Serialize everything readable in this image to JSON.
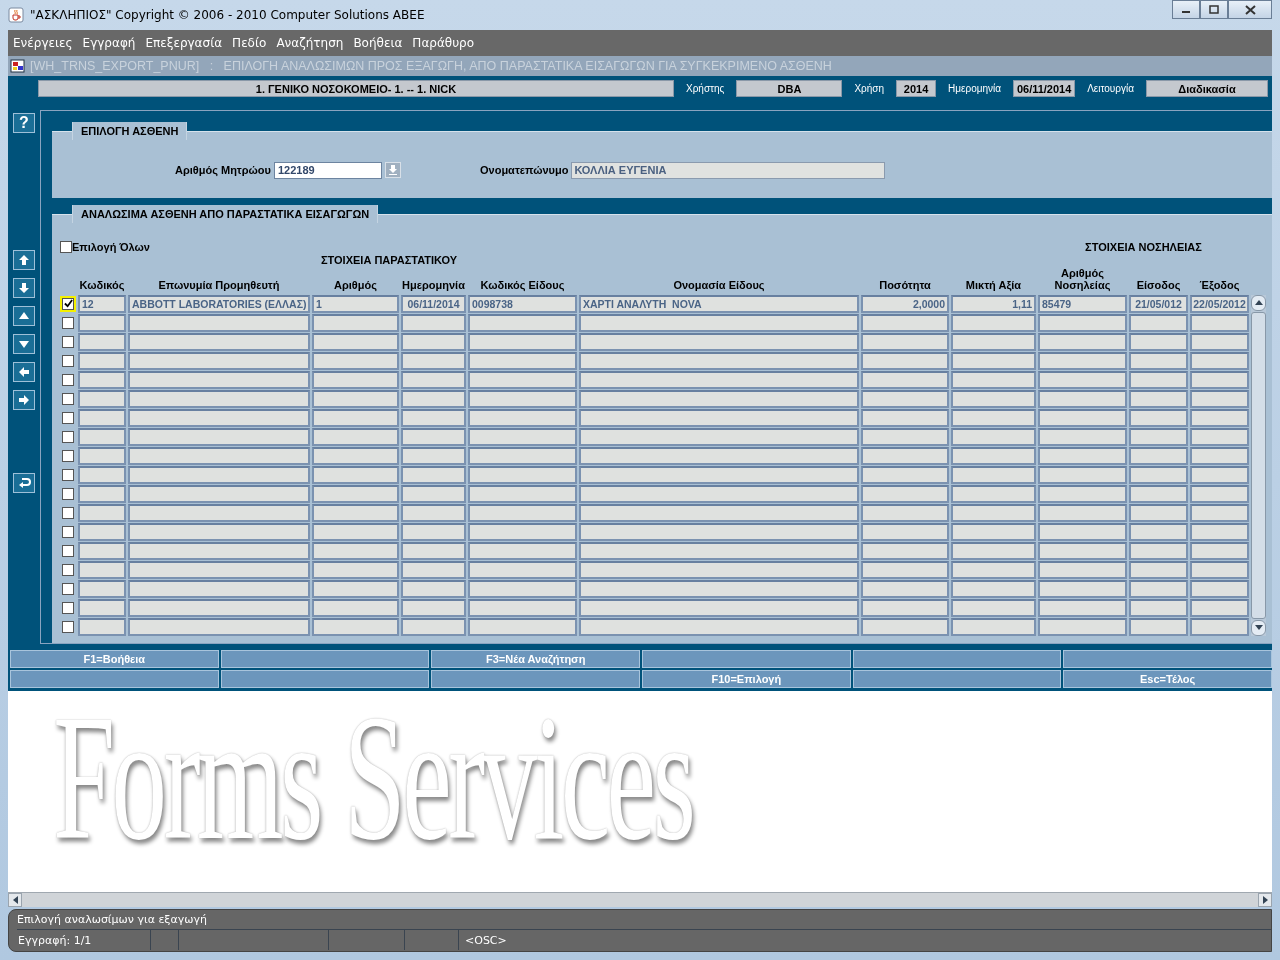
{
  "window": {
    "title": "\"ΑΣΚΛΗΠΙΟΣ\" Copyright © 2006 - 2010 Computer Solutions ABEE"
  },
  "menu": [
    "Ενέργειες",
    "Εγγραφή",
    "Επεξεργασία",
    "Πεδίο",
    "Αναζήτηση",
    "Βοήθεια",
    "Παράθυρο"
  ],
  "form_title": "[WH_TRNS_EXPORT_PNUR]   :   ΕΠΙΛΟΓΗ ΑΝΑΛΩΣΙΜΩΝ ΠΡΟΣ ΕΞΑΓΩΓΗ, ΑΠΟ ΠΑΡΑΣΤΑΤΙΚΑ ΕΙΣΑΓΩΓΩΝ ΓΙΑ ΣΥΓΚΕΚΡΙΜΕΝΟ ΑΣΘΕΝΗ",
  "header": {
    "hospital": "1. ΓΕΝΙΚΟ ΝΟΣΟΚΟΜΕΙΟ- 1. -- 1. NICK",
    "user_label": "Χρήστης",
    "user": "DBA",
    "year_label": "Χρήση",
    "year": "2014",
    "date_label": "Ημερομηνία",
    "date": "06/11/2014",
    "function_label": "Λειτουργία",
    "function": "Διαδικασία"
  },
  "toolbar": {
    "help": "?"
  },
  "patient": {
    "title": "ΕΠΙΛΟΓΗ ΑΣΘΕΝΗ",
    "record_label": "Αριθμός Μητρώου",
    "record": "122189",
    "name_label": "Ονοματεπώνυμο",
    "name": "ΚΟΛΛΙΑ ΕΥΓΕΝΙΑ"
  },
  "items": {
    "title": "ΑΝΑΛΩΣΙΜΑ ΑΣΘΕΝΗ ΑΠΟ ΠΑΡΑΣΤΑΤΙΚΑ ΕΙΣΑΓΩΓΩΝ",
    "select_all": {
      "label": "Επιλογή Όλων",
      "checked": false
    },
    "groups": [
      "ΣΤΟΙΧΕΙΑ ΠΑΡΑΣΤΑΤΙΚΟΥ",
      "ΣΤΟΙΧΕΙΑ ΝΟΣΗΛΕΙΑΣ"
    ],
    "columns": [
      "Κωδικός",
      "Επωνυμία Προμηθευτή",
      "Αριθμός",
      "Ημερομηνία",
      "Κωδικός Είδους",
      "Ονομασία Είδους",
      "Ποσότητα",
      "Μικτή Αξία",
      "Αριθμός Νοσηλείας",
      "Είσοδος",
      "Έξοδος"
    ],
    "rows": [
      {
        "checked": true,
        "selected": true,
        "cells": [
          "12",
          "ABBOTT LABORATORIES (ΕΛΛΑΣ)",
          "1",
          "06/11/2014",
          "0098738",
          "ΧΑΡΤΙ ΑΝΑΛΥΤΗ  NOVA",
          "2,0000",
          "1,11",
          "85479",
          "21/05/012",
          "22/05/2012"
        ]
      },
      {
        "checked": false,
        "selected": false
      },
      {
        "checked": false,
        "selected": false
      },
      {
        "checked": false,
        "selected": false
      },
      {
        "checked": false,
        "selected": false
      },
      {
        "checked": false,
        "selected": false
      },
      {
        "checked": false,
        "selected": false
      },
      {
        "checked": false,
        "selected": false
      },
      {
        "checked": false,
        "selected": false
      },
      {
        "checked": false,
        "selected": false
      },
      {
        "checked": false,
        "selected": false
      },
      {
        "checked": false,
        "selected": false
      },
      {
        "checked": false,
        "selected": false
      },
      {
        "checked": false,
        "selected": false
      },
      {
        "checked": false,
        "selected": false
      },
      {
        "checked": false,
        "selected": false
      },
      {
        "checked": false,
        "selected": false
      },
      {
        "checked": false,
        "selected": false
      }
    ]
  },
  "function_keys": {
    "slot_1": "F1=Βοήθεια",
    "slot_3": "F3=Νέα Αναζήτηση",
    "slot_10": "F10=Επιλογή",
    "slot_12": "Esc=Τέλος"
  },
  "background_logo": "Forms Services",
  "status": {
    "message": "Επιλογή αναλωσίμων για εξαγωγή",
    "record": "Εγγραφή: 1/1",
    "mode": "<OSC>"
  }
}
